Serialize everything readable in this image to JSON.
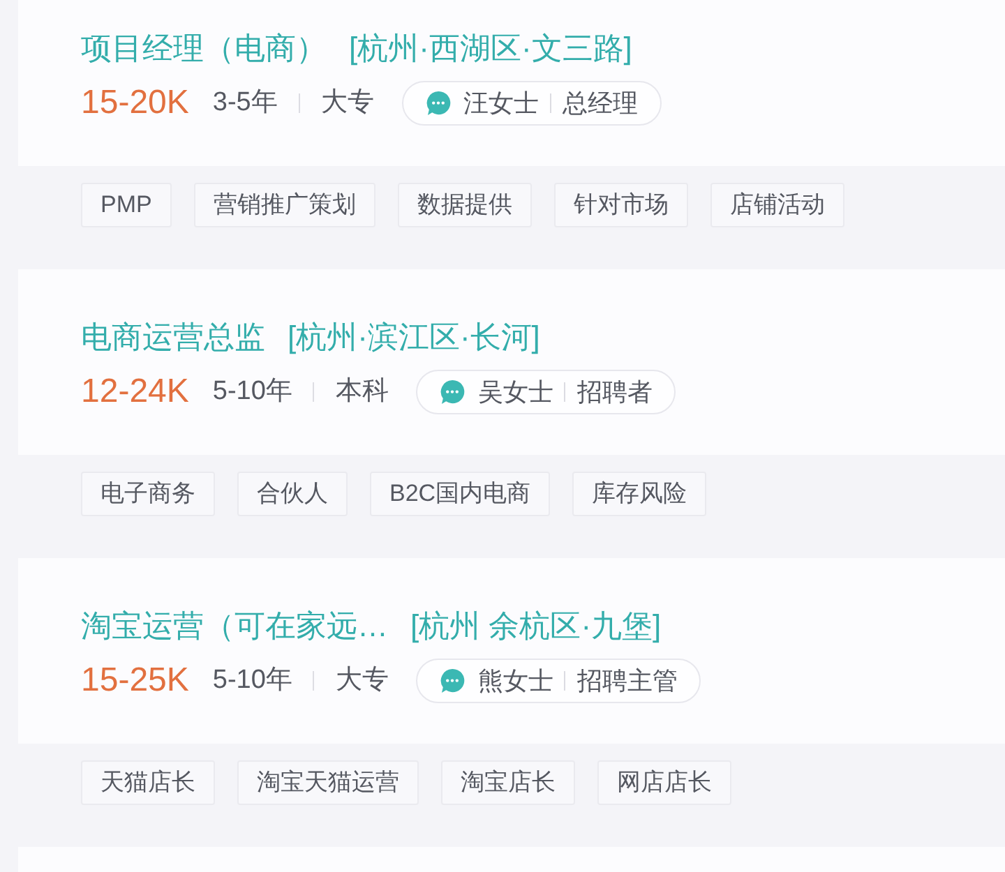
{
  "jobs": [
    {
      "title": "项目经理（电商）",
      "location": "[杭州·西湖区·文三路]",
      "salary": "15-20K",
      "experience": "3-5年",
      "education": "大专",
      "recruiter": {
        "name": "汪女士",
        "role": "总经理"
      },
      "tags": [
        "PMP",
        "营销推广策划",
        "数据提供",
        "针对市场",
        "店铺活动"
      ]
    },
    {
      "title": "电商运营总监",
      "location": "[杭州·滨江区·长河]",
      "salary": "12-24K",
      "experience": "5-10年",
      "education": "本科",
      "recruiter": {
        "name": "吴女士",
        "role": "招聘者"
      },
      "tags": [
        "电子商务",
        "合伙人",
        "B2C国内电商",
        "库存风险"
      ]
    },
    {
      "title": "淘宝运营（可在家远…",
      "location": "[杭州 余杭区·九堡]",
      "salary": "15-25K",
      "experience": "5-10年",
      "education": "大专",
      "recruiter": {
        "name": "熊女士",
        "role": "招聘主管"
      },
      "tags": [
        "天猫店长",
        "淘宝天猫运营",
        "淘宝店长",
        "网店店长"
      ]
    }
  ]
}
